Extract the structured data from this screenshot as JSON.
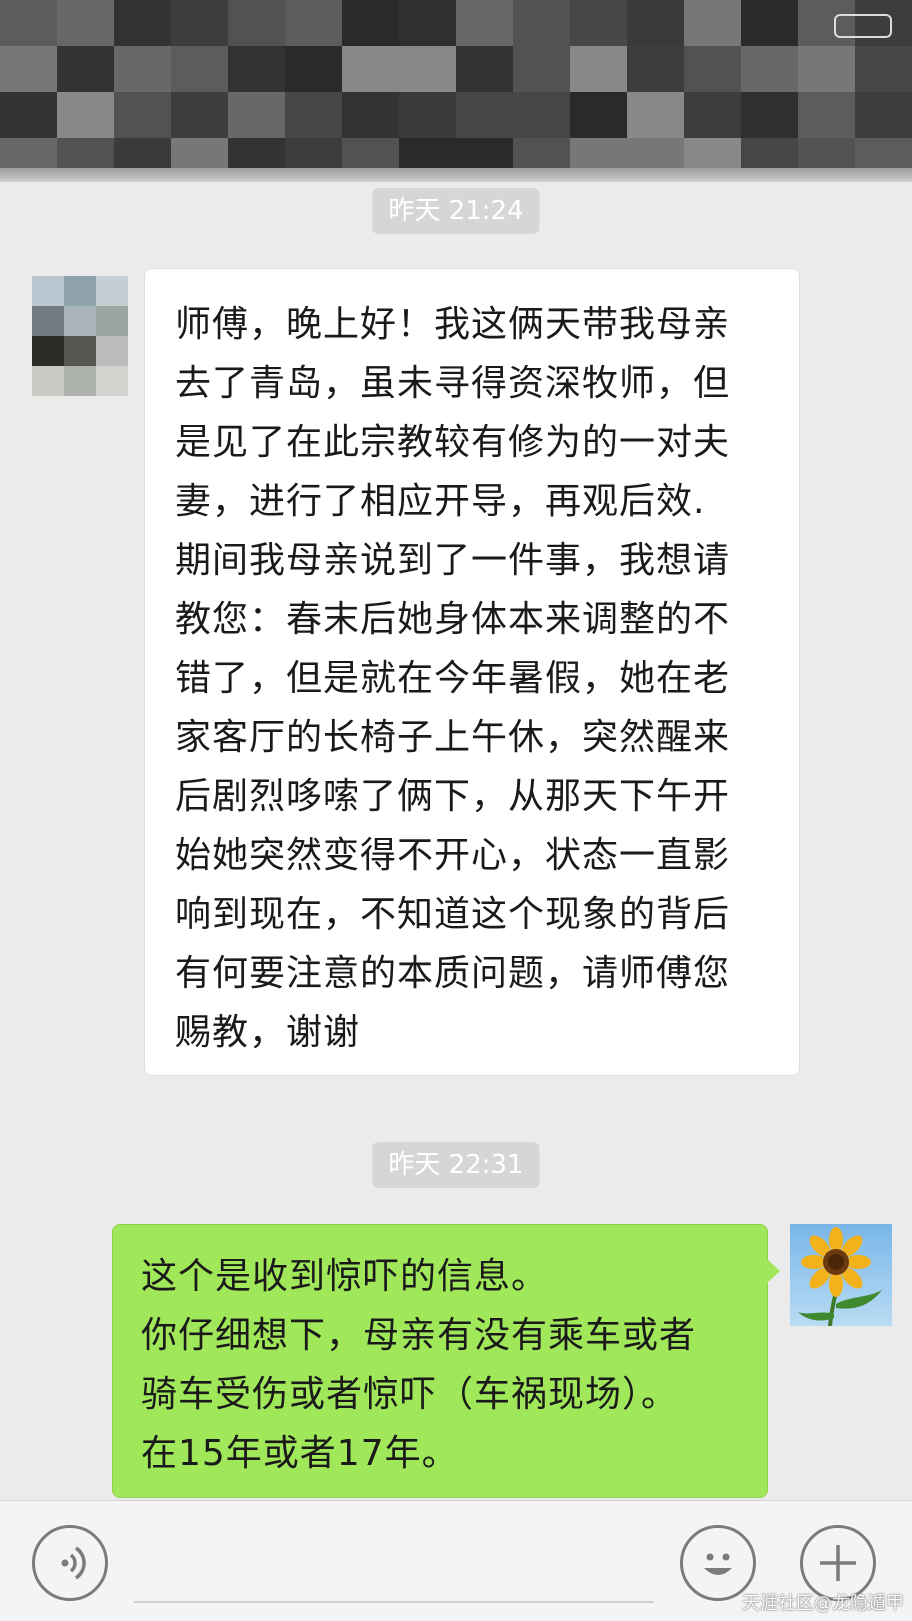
{
  "chat": {
    "messages": [
      {
        "timestamp": "昨天 21:24",
        "sender": "contact",
        "lines": [
          "师傅，晚上好！我这俩天带我母亲",
          "去了青岛，虽未寻得资深牧师，但",
          "是见了在此宗教较有修为的一对夫",
          "妻，进行了相应开导，再观后效.",
          "期间我母亲说到了一件事，我想请",
          "教您：春末后她身体本来调整的不",
          "错了，但是就在今年暑假，她在老",
          "家客厅的长椅子上午休，突然醒来",
          "后剧烈哆嗦了俩下，从那天下午开",
          "始她突然变得不开心，状态一直影",
          "响到现在，不知道这个现象的背后",
          "有何要注意的本质问题，请师傅您",
          "赐教，谢谢"
        ]
      },
      {
        "timestamp": "昨天 22:31",
        "sender": "self",
        "lines": [
          "这个是收到惊吓的信息。",
          "你仔细想下，母亲有没有乘车或者",
          "骑车受伤或者惊吓（车祸现场）。",
          "在15年或者17年。"
        ]
      }
    ]
  },
  "input_bar": {
    "voice_icon": "voice-icon",
    "emoji_icon": "emoji-icon",
    "plus_icon": "plus-icon"
  },
  "watermark": "天涯社区@龙隐遁甲",
  "colors": {
    "background": "#ebebeb",
    "incoming_bubble": "#ffffff",
    "outgoing_bubble": "#a0e759",
    "timestamp_bg": "#d6d6d6"
  }
}
